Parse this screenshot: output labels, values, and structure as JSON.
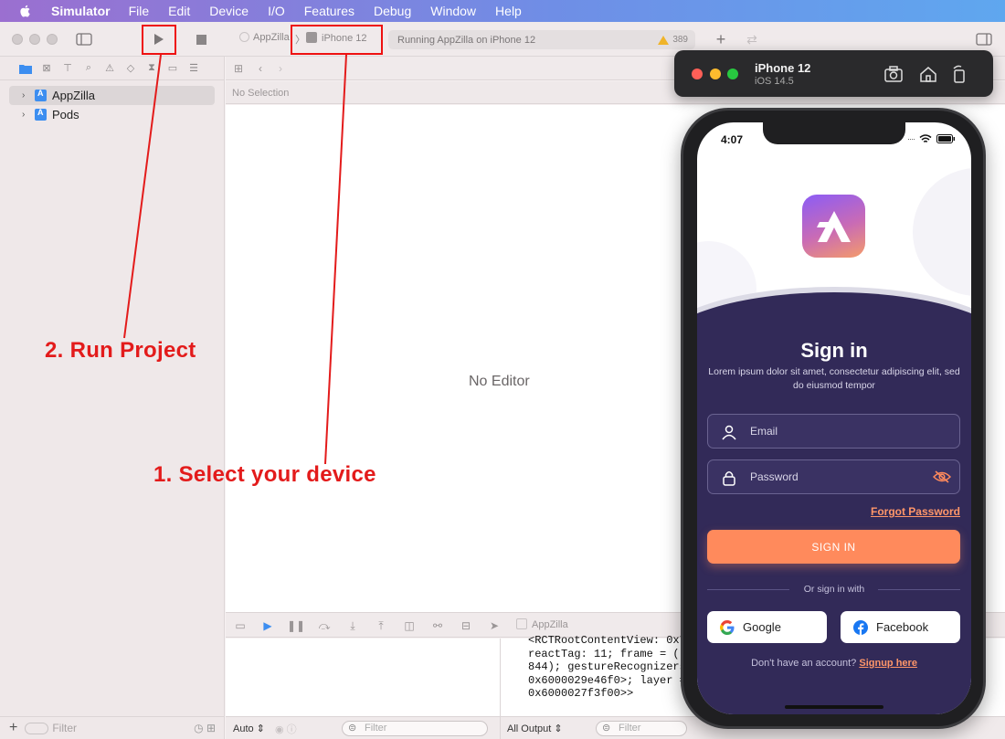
{
  "menubar": {
    "app_name": "Simulator",
    "items": [
      "File",
      "Edit",
      "Device",
      "I/O",
      "Features",
      "Debug",
      "Window",
      "Help"
    ]
  },
  "xcode": {
    "scheme": "AppZilla",
    "device": "iPhone 12",
    "status": "Running AppZilla on iPhone 12",
    "warning_count": "389",
    "navigator": {
      "items": [
        {
          "label": "AppZilla"
        },
        {
          "label": "Pods"
        }
      ],
      "filter_placeholder": "Filter"
    },
    "editor": {
      "selection_label": "No Selection",
      "empty_label": "No Editor"
    },
    "debug": {
      "target": "AppZilla",
      "console_text": "<RCTRootContentView: 0x7\nreactTag: 11; frame = ((\n844); gestureRecognizers\n0x6000029e46f0>; layer =\n0x6000027f3f00>>",
      "auto_label": "Auto ⇕",
      "all_output_label": "All Output ⇕",
      "filter_placeholder": "Filter"
    }
  },
  "annotations": {
    "run_project": "2. Run Project",
    "select_device": "1. Select your device"
  },
  "simulator": {
    "device_name": "iPhone 12",
    "os_version": "iOS 14.5"
  },
  "phone_app": {
    "time": "4:07",
    "title": "Sign in",
    "subtitle": "Lorem ipsum dolor sit amet, consectetur adipiscing elit, sed do eiusmod tempor",
    "email_placeholder": "Email",
    "password_placeholder": "Password",
    "forgot_password": "Forgot Password",
    "signin_button": "SIGN IN",
    "or_sign_in_with": "Or sign in with",
    "google": "Google",
    "facebook": "Facebook",
    "no_account": "Don't have an account?",
    "signup_link": "Signup here"
  },
  "colors": {
    "panel": "#322a58",
    "accent": "#ff8a5c",
    "annotation": "#e31b1b"
  }
}
